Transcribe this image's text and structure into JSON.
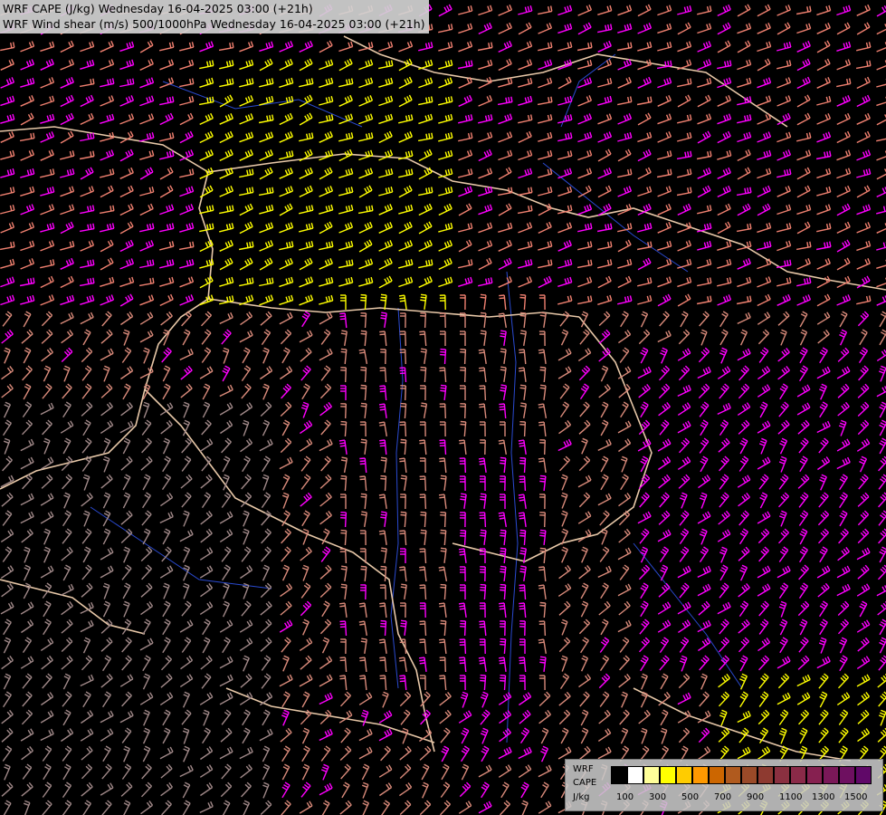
{
  "title": {
    "line1": "WRF CAPE (J/kg) Wednesday 16-04-2025 03:00 (+21h)",
    "line2": "WRF Wind shear (m/s) 500/1000hPa Wednesday 16-04-2025 03:00 (+21h)"
  },
  "legend": {
    "model": "WRF",
    "field": "CAPE",
    "unit": "J/kg",
    "colors": [
      "#000000",
      "#ffffff",
      "#ffff99",
      "#ffff00",
      "#ffcc00",
      "#ff9900",
      "#cc6600",
      "#b05a1e",
      "#9a4a28",
      "#8e3a30",
      "#8a3040",
      "#8a2a48",
      "#862050",
      "#7a1858",
      "#6e1060",
      "#600868"
    ],
    "ticks": [
      "100",
      "300",
      "500",
      "700",
      "900",
      "1100",
      "1300",
      "1500"
    ]
  },
  "colors": {
    "background": "#000000",
    "barb_default": "#d98a7a",
    "barb_salmon": "#f08070",
    "barb_magenta": "#ff00ff",
    "barb_yellow": "#ffff00",
    "barb_grey": "#a08888",
    "border": "#e8c8a8",
    "river": "#2244cc"
  }
}
